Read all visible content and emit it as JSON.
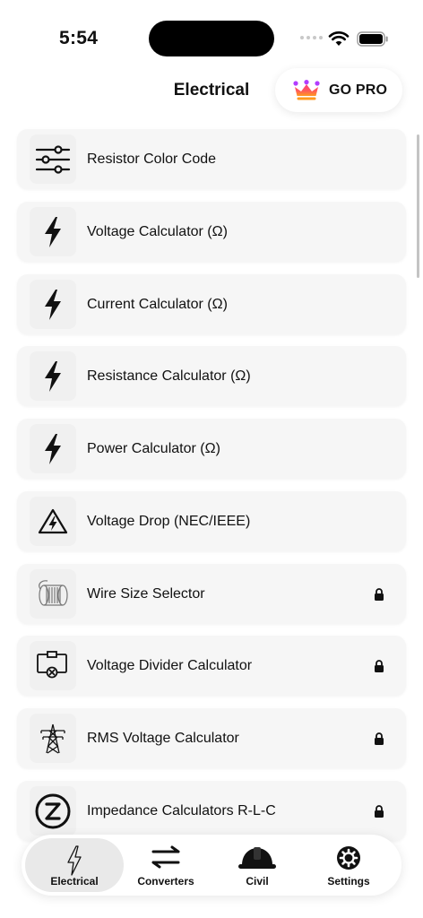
{
  "status_bar": {
    "time": "5:54"
  },
  "header": {
    "title": "Electrical",
    "pro_label": "GO PRO",
    "pro_icon": "crown-icon"
  },
  "items": [
    {
      "label": "Resistor Color Code",
      "icon": "sliders-icon",
      "locked": false
    },
    {
      "label": "Voltage Calculator (Ω)",
      "icon": "bolt-icon",
      "locked": false
    },
    {
      "label": "Current Calculator (Ω)",
      "icon": "bolt-icon",
      "locked": false
    },
    {
      "label": "Resistance Calculator (Ω)",
      "icon": "bolt-icon",
      "locked": false
    },
    {
      "label": "Power Calculator (Ω)",
      "icon": "bolt-icon",
      "locked": false
    },
    {
      "label": "Voltage Drop (NEC/IEEE)",
      "icon": "warning-bolt-icon",
      "locked": false
    },
    {
      "label": "Wire Size Selector",
      "icon": "wire-spool-icon",
      "locked": true
    },
    {
      "label": "Voltage Divider Calculator",
      "icon": "circuit-icon",
      "locked": true
    },
    {
      "label": "RMS Voltage Calculator",
      "icon": "transmission-tower-icon",
      "locked": true
    },
    {
      "label": "Impedance Calculators R-L-C",
      "icon": "impedance-z-icon",
      "locked": true
    }
  ],
  "tabs": [
    {
      "label": "Electrical",
      "icon": "bolt-outline-icon",
      "active": true
    },
    {
      "label": "Converters",
      "icon": "swap-arrows-icon",
      "active": false
    },
    {
      "label": "Civil",
      "icon": "hard-hat-icon",
      "active": false
    },
    {
      "label": "Settings",
      "icon": "gear-icon",
      "active": false
    }
  ]
}
